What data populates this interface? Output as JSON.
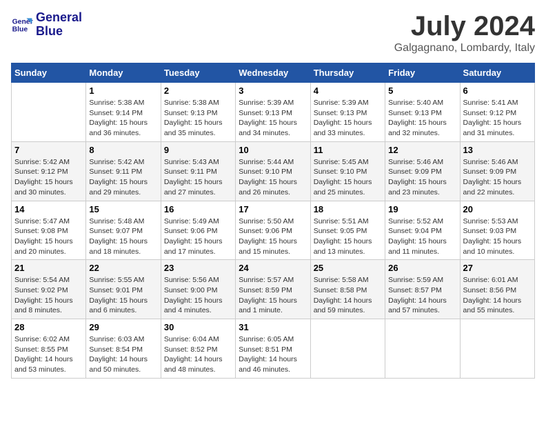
{
  "header": {
    "logo_line1": "General",
    "logo_line2": "Blue",
    "month_year": "July 2024",
    "location": "Galgagnano, Lombardy, Italy"
  },
  "days_of_week": [
    "Sunday",
    "Monday",
    "Tuesday",
    "Wednesday",
    "Thursday",
    "Friday",
    "Saturday"
  ],
  "weeks": [
    [
      {
        "day": "",
        "sunrise": "",
        "sunset": "",
        "daylight": ""
      },
      {
        "day": "1",
        "sunrise": "Sunrise: 5:38 AM",
        "sunset": "Sunset: 9:14 PM",
        "daylight": "Daylight: 15 hours and 36 minutes."
      },
      {
        "day": "2",
        "sunrise": "Sunrise: 5:38 AM",
        "sunset": "Sunset: 9:13 PM",
        "daylight": "Daylight: 15 hours and 35 minutes."
      },
      {
        "day": "3",
        "sunrise": "Sunrise: 5:39 AM",
        "sunset": "Sunset: 9:13 PM",
        "daylight": "Daylight: 15 hours and 34 minutes."
      },
      {
        "day": "4",
        "sunrise": "Sunrise: 5:39 AM",
        "sunset": "Sunset: 9:13 PM",
        "daylight": "Daylight: 15 hours and 33 minutes."
      },
      {
        "day": "5",
        "sunrise": "Sunrise: 5:40 AM",
        "sunset": "Sunset: 9:13 PM",
        "daylight": "Daylight: 15 hours and 32 minutes."
      },
      {
        "day": "6",
        "sunrise": "Sunrise: 5:41 AM",
        "sunset": "Sunset: 9:12 PM",
        "daylight": "Daylight: 15 hours and 31 minutes."
      }
    ],
    [
      {
        "day": "7",
        "sunrise": "Sunrise: 5:42 AM",
        "sunset": "Sunset: 9:12 PM",
        "daylight": "Daylight: 15 hours and 30 minutes."
      },
      {
        "day": "8",
        "sunrise": "Sunrise: 5:42 AM",
        "sunset": "Sunset: 9:11 PM",
        "daylight": "Daylight: 15 hours and 29 minutes."
      },
      {
        "day": "9",
        "sunrise": "Sunrise: 5:43 AM",
        "sunset": "Sunset: 9:11 PM",
        "daylight": "Daylight: 15 hours and 27 minutes."
      },
      {
        "day": "10",
        "sunrise": "Sunrise: 5:44 AM",
        "sunset": "Sunset: 9:10 PM",
        "daylight": "Daylight: 15 hours and 26 minutes."
      },
      {
        "day": "11",
        "sunrise": "Sunrise: 5:45 AM",
        "sunset": "Sunset: 9:10 PM",
        "daylight": "Daylight: 15 hours and 25 minutes."
      },
      {
        "day": "12",
        "sunrise": "Sunrise: 5:46 AM",
        "sunset": "Sunset: 9:09 PM",
        "daylight": "Daylight: 15 hours and 23 minutes."
      },
      {
        "day": "13",
        "sunrise": "Sunrise: 5:46 AM",
        "sunset": "Sunset: 9:09 PM",
        "daylight": "Daylight: 15 hours and 22 minutes."
      }
    ],
    [
      {
        "day": "14",
        "sunrise": "Sunrise: 5:47 AM",
        "sunset": "Sunset: 9:08 PM",
        "daylight": "Daylight: 15 hours and 20 minutes."
      },
      {
        "day": "15",
        "sunrise": "Sunrise: 5:48 AM",
        "sunset": "Sunset: 9:07 PM",
        "daylight": "Daylight: 15 hours and 18 minutes."
      },
      {
        "day": "16",
        "sunrise": "Sunrise: 5:49 AM",
        "sunset": "Sunset: 9:06 PM",
        "daylight": "Daylight: 15 hours and 17 minutes."
      },
      {
        "day": "17",
        "sunrise": "Sunrise: 5:50 AM",
        "sunset": "Sunset: 9:06 PM",
        "daylight": "Daylight: 15 hours and 15 minutes."
      },
      {
        "day": "18",
        "sunrise": "Sunrise: 5:51 AM",
        "sunset": "Sunset: 9:05 PM",
        "daylight": "Daylight: 15 hours and 13 minutes."
      },
      {
        "day": "19",
        "sunrise": "Sunrise: 5:52 AM",
        "sunset": "Sunset: 9:04 PM",
        "daylight": "Daylight: 15 hours and 11 minutes."
      },
      {
        "day": "20",
        "sunrise": "Sunrise: 5:53 AM",
        "sunset": "Sunset: 9:03 PM",
        "daylight": "Daylight: 15 hours and 10 minutes."
      }
    ],
    [
      {
        "day": "21",
        "sunrise": "Sunrise: 5:54 AM",
        "sunset": "Sunset: 9:02 PM",
        "daylight": "Daylight: 15 hours and 8 minutes."
      },
      {
        "day": "22",
        "sunrise": "Sunrise: 5:55 AM",
        "sunset": "Sunset: 9:01 PM",
        "daylight": "Daylight: 15 hours and 6 minutes."
      },
      {
        "day": "23",
        "sunrise": "Sunrise: 5:56 AM",
        "sunset": "Sunset: 9:00 PM",
        "daylight": "Daylight: 15 hours and 4 minutes."
      },
      {
        "day": "24",
        "sunrise": "Sunrise: 5:57 AM",
        "sunset": "Sunset: 8:59 PM",
        "daylight": "Daylight: 15 hours and 1 minute."
      },
      {
        "day": "25",
        "sunrise": "Sunrise: 5:58 AM",
        "sunset": "Sunset: 8:58 PM",
        "daylight": "Daylight: 14 hours and 59 minutes."
      },
      {
        "day": "26",
        "sunrise": "Sunrise: 5:59 AM",
        "sunset": "Sunset: 8:57 PM",
        "daylight": "Daylight: 14 hours and 57 minutes."
      },
      {
        "day": "27",
        "sunrise": "Sunrise: 6:01 AM",
        "sunset": "Sunset: 8:56 PM",
        "daylight": "Daylight: 14 hours and 55 minutes."
      }
    ],
    [
      {
        "day": "28",
        "sunrise": "Sunrise: 6:02 AM",
        "sunset": "Sunset: 8:55 PM",
        "daylight": "Daylight: 14 hours and 53 minutes."
      },
      {
        "day": "29",
        "sunrise": "Sunrise: 6:03 AM",
        "sunset": "Sunset: 8:54 PM",
        "daylight": "Daylight: 14 hours and 50 minutes."
      },
      {
        "day": "30",
        "sunrise": "Sunrise: 6:04 AM",
        "sunset": "Sunset: 8:52 PM",
        "daylight": "Daylight: 14 hours and 48 minutes."
      },
      {
        "day": "31",
        "sunrise": "Sunrise: 6:05 AM",
        "sunset": "Sunset: 8:51 PM",
        "daylight": "Daylight: 14 hours and 46 minutes."
      },
      {
        "day": "",
        "sunrise": "",
        "sunset": "",
        "daylight": ""
      },
      {
        "day": "",
        "sunrise": "",
        "sunset": "",
        "daylight": ""
      },
      {
        "day": "",
        "sunrise": "",
        "sunset": "",
        "daylight": ""
      }
    ]
  ]
}
